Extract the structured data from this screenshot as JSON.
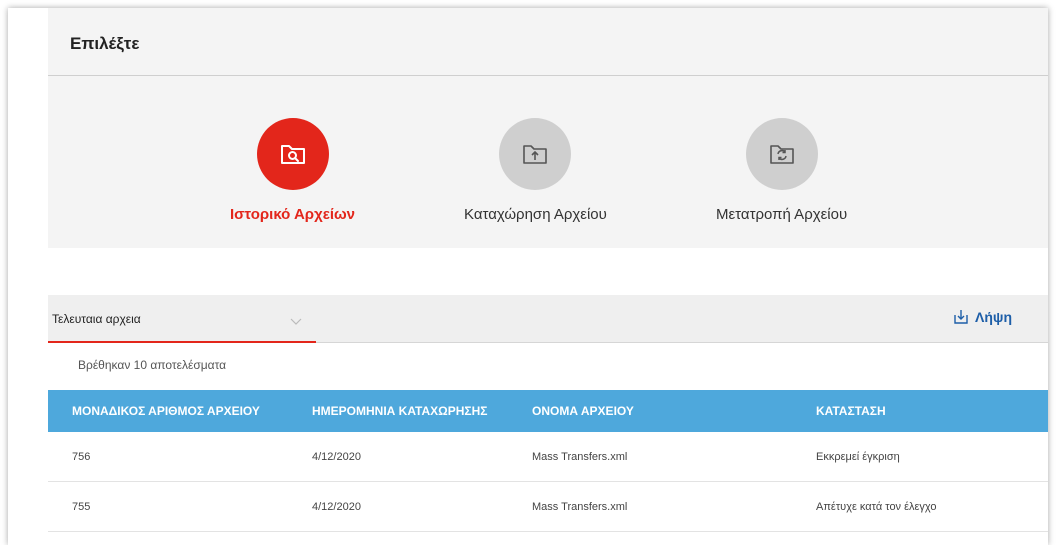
{
  "select_section": {
    "title": "Επιλέξτε",
    "options": [
      {
        "label": "Ιστορικό Αρχείων",
        "icon": "folder-search-icon",
        "active": true
      },
      {
        "label": "Καταχώρηση Αρχείου",
        "icon": "folder-upload-icon",
        "active": false
      },
      {
        "label": "Μετατροπή Αρχείου",
        "icon": "folder-convert-icon",
        "active": false
      }
    ]
  },
  "toolbar": {
    "dropdown_label": "Τελευταια αρχεια",
    "download_label": "Λήψη"
  },
  "results_text": "Βρέθηκαν 10 αποτελέσματα",
  "table": {
    "headers": [
      "ΜΟΝΑΔΙΚΟΣ ΑΡΙΘΜΟΣ ΑΡΧΕΙΟΥ",
      "ΗΜΕΡΟΜΗΝΙΑ ΚΑΤΑΧΩΡΗΣΗΣ",
      "ΟΝΟΜΑ ΑΡΧΕΙΟΥ",
      "ΚΑΤΑΣΤΑΣΗ"
    ],
    "rows": [
      [
        "756",
        "4/12/2020",
        "Mass Transfers.xml",
        "Εκκρεμεί έγκριση"
      ],
      [
        "755",
        "4/12/2020",
        "Mass Transfers.xml",
        "Απέτυχε κατά τον έλεγχο"
      ]
    ]
  },
  "colors": {
    "accent_red": "#e3261b",
    "header_blue": "#4ea8dc",
    "link_blue": "#1d5ea8"
  }
}
